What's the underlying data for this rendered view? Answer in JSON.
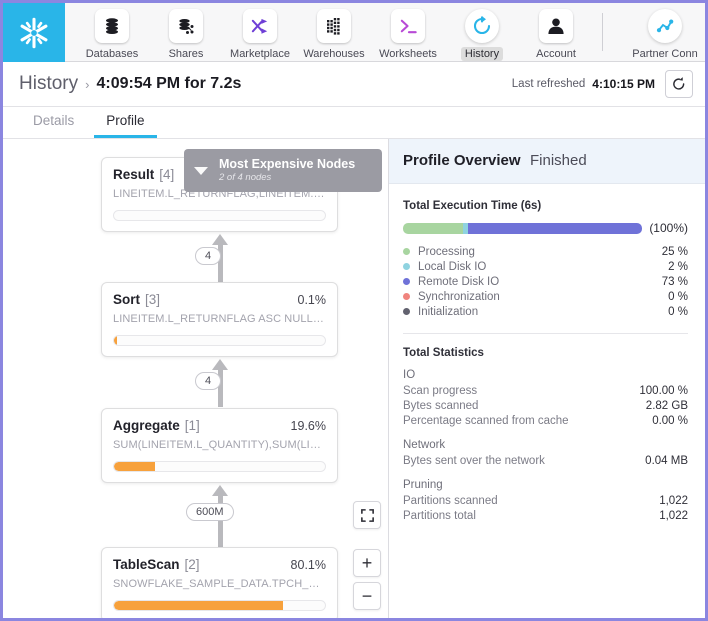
{
  "topnav": {
    "logo": "snowflake-logo",
    "items": [
      {
        "label": "Databases",
        "icon": "databases-icon",
        "active": false
      },
      {
        "label": "Shares",
        "icon": "shares-icon",
        "active": false
      },
      {
        "label": "Marketplace",
        "icon": "marketplace-icon",
        "active": false
      },
      {
        "label": "Warehouses",
        "icon": "warehouses-icon",
        "active": false
      },
      {
        "label": "Worksheets",
        "icon": "worksheets-icon",
        "active": false
      },
      {
        "label": "History",
        "icon": "history-icon",
        "active": true
      },
      {
        "label": "Account",
        "icon": "account-icon",
        "active": false
      }
    ],
    "partner": {
      "label": "Partner Conn",
      "icon": "partner-connect-icon"
    }
  },
  "breadcrumb": {
    "root": "History",
    "separator": "›",
    "current": "4:09:54 PM for 7.2s",
    "refreshed_label": "Last refreshed",
    "refreshed_time": "4:10:15 PM",
    "refresh_icon": "refresh-icon"
  },
  "tabs": [
    {
      "label": "Details",
      "active": false
    },
    {
      "label": "Profile",
      "active": true
    }
  ],
  "graph": {
    "expensive_panel": {
      "title": "Most Expensive Nodes",
      "subtitle": "2 of 4 nodes",
      "caret_icon": "chevron-down-icon"
    },
    "nodes": [
      {
        "title": "Result",
        "id": "[4]",
        "pct": "",
        "subtitle": "LINEITEM.L_RETURNFLAG,LINEITEM.L_LIN…",
        "bar_pct": 0
      },
      {
        "title": "Sort",
        "id": "[3]",
        "pct": "0.1%",
        "subtitle": "LINEITEM.L_RETURNFLAG ASC NULLS LA…",
        "bar_pct": 1
      },
      {
        "title": "Aggregate",
        "id": "[1]",
        "pct": "19.6%",
        "subtitle": "SUM(LINEITEM.L_QUANTITY),SUM(LINEIT…",
        "bar_pct": 19.6
      },
      {
        "title": "TableScan",
        "id": "[2]",
        "pct": "80.1%",
        "subtitle": "SNOWFLAKE_SAMPLE_DATA.TPCH_SF100….",
        "bar_pct": 80.1
      }
    ],
    "edges": [
      {
        "label": "4"
      },
      {
        "label": "4"
      },
      {
        "label": "600M"
      }
    ],
    "controls": {
      "fit": "fit-to-screen-icon",
      "zoom_in": "+",
      "zoom_out": "−"
    },
    "bar_color": "#f7a13c"
  },
  "overview": {
    "title": "Profile Overview",
    "status": "Finished",
    "exec_section_title": "Total Execution Time (6s)",
    "exec_total_label": "(100%)",
    "breakdown": [
      {
        "label": "Processing",
        "value": "25 %",
        "pct": 25,
        "color": "#a8d5a0"
      },
      {
        "label": "Local Disk IO",
        "value": "2 %",
        "pct": 2,
        "color": "#8fd3e0"
      },
      {
        "label": "Remote Disk IO",
        "value": "73 %",
        "pct": 73,
        "color": "#6f72d8"
      },
      {
        "label": "Synchronization",
        "value": "0 %",
        "pct": 0,
        "color": "#f0847e"
      },
      {
        "label": "Initialization",
        "value": "0 %",
        "pct": 0,
        "color": "#62626f"
      }
    ],
    "stats_title": "Total Statistics",
    "groups": [
      {
        "name": "IO",
        "rows": [
          {
            "label": "Scan progress",
            "value": "100.00 %"
          },
          {
            "label": "Bytes scanned",
            "value": "2.82 GB"
          },
          {
            "label": "Percentage scanned from cache",
            "value": "0.00 %"
          }
        ]
      },
      {
        "name": "Network",
        "rows": [
          {
            "label": "Bytes sent over the network",
            "value": "0.04 MB"
          }
        ]
      },
      {
        "name": "Pruning",
        "rows": [
          {
            "label": "Partitions scanned",
            "value": "1,022"
          },
          {
            "label": "Partitions total",
            "value": "1,022"
          }
        ]
      }
    ]
  },
  "colors": {
    "brand": "#29b5e8",
    "window_border": "#8b86e0",
    "orange_bar": "#f7a13c"
  }
}
